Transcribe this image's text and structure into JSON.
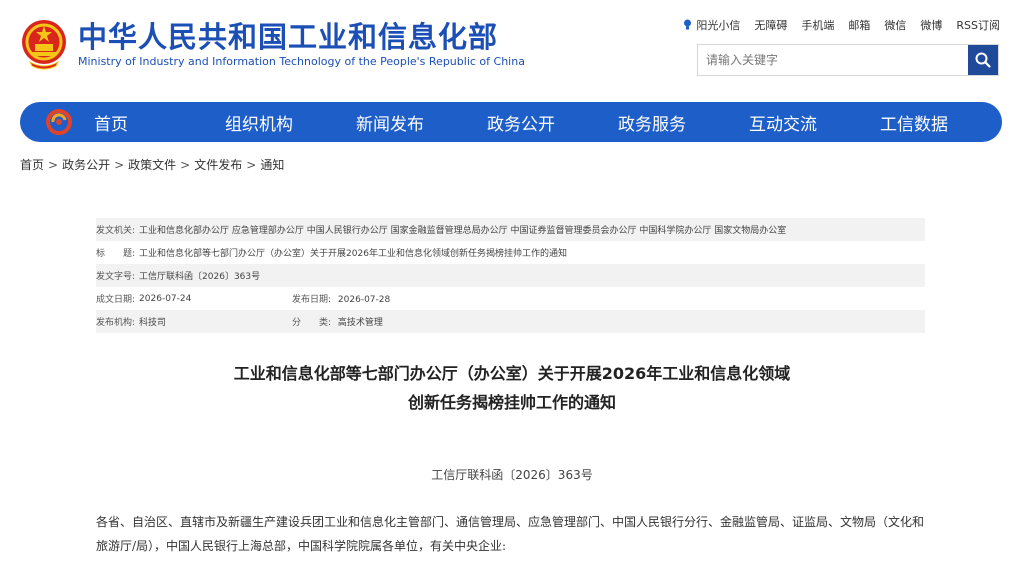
{
  "header": {
    "title": "中华人民共和国工业和信息化部",
    "subtitle": "Ministry of Industry and Information Technology of the People's Republic of China",
    "emblem_icon": "national-emblem-icon"
  },
  "top_links": [
    "阳光小信",
    "无障碍",
    "手机端",
    "邮箱",
    "微信",
    "微博",
    "RSS订阅"
  ],
  "search": {
    "placeholder": "请输入关键字",
    "button_icon": "search-icon"
  },
  "nav": {
    "logo_icon": "miit-logo-icon",
    "items": [
      "首页",
      "组织机构",
      "新闻发布",
      "政务公开",
      "政务服务",
      "互动交流",
      "工信数据"
    ]
  },
  "breadcrumb": [
    "首页",
    "政务公开",
    "政策文件",
    "文件发布",
    "通知"
  ],
  "info": {
    "issuer_label": "发文机关:",
    "issuer_value": "工业和信息化部办公厅 应急管理部办公厅 中国人民银行办公厅 国家金融监督管理总局办公厅 中国证券监督管理委员会办公厅 中国科学院办公厅 国家文物局办公室",
    "title_label": "标　　题:",
    "title_value": "工业和信息化部等七部门办公厅（办公室）关于开展2026年工业和信息化领域创新任务揭榜挂帅工作的通知",
    "doc_no_label": "发文字号:",
    "doc_no_value": "工信厅联科函〔2026〕363号",
    "date_label": "成文日期:",
    "date_value": "2026-07-24",
    "pub_date_label": "发布日期:",
    "pub_date_value": "2026-07-28",
    "org_label": "发布机构:",
    "org_value": "科技司",
    "category_label": "分　　类:",
    "category_value": "高技术管理"
  },
  "article": {
    "title_line1": "工业和信息化部等七部门办公厅（办公室）关于开展2026年工业和信息化领域",
    "title_line2": "创新任务揭榜挂帅工作的通知",
    "doc_number": "工信厅联科函〔2026〕363号",
    "body": "各省、自治区、直辖市及新疆生产建设兵团工业和信息化主管部门、通信管理局、应急管理部门、中国人民银行分行、金融监管局、证监局、文物局（文化和旅游厅/局），中国人民银行上海总部，中国科学院院属各单位，有关中央企业:"
  },
  "colors": {
    "brand_blue": "#1b4fb5",
    "nav_blue": "#1e5ec8",
    "search_button": "#1f4a9a",
    "row_shade": "#f2f2f2"
  }
}
